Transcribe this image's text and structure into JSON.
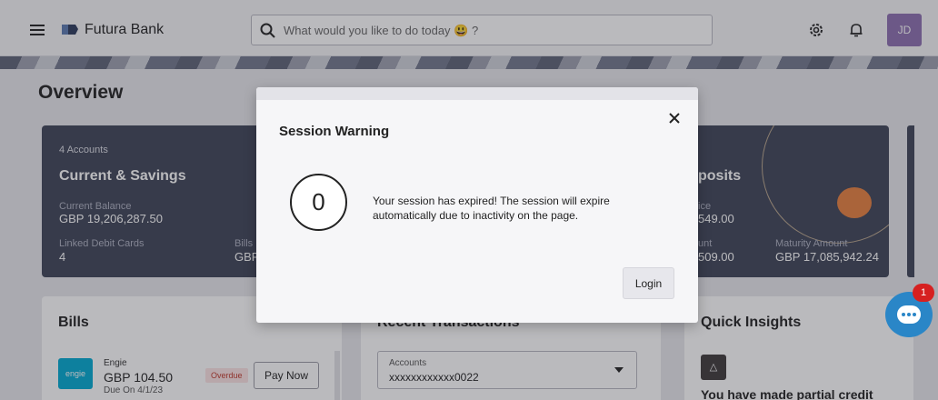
{
  "header": {
    "brand": "Futura Bank",
    "search_placeholder": "What would you like to do today 😃 ?",
    "avatar_initials": "JD"
  },
  "page": {
    "title": "Overview"
  },
  "summary_card": {
    "accounts_count": "4 Accounts",
    "heading": "Current & Savings",
    "current_balance_label": "Current Balance",
    "current_balance_value": "GBP 19,206,287.50",
    "linked_cards_label": "Linked Debit Cards",
    "linked_cards_value": "4",
    "bills_label": "Bills",
    "bills_value": "GBP",
    "deposits_heading": "posits",
    "deposit_label_1": "ice",
    "deposit_value_1": "549.00",
    "deposit_label_2": "unt",
    "deposit_value_2": "509.00",
    "maturity_label": "Maturity Amount",
    "maturity_value": "GBP 17,085,942.24"
  },
  "bills_panel": {
    "title": "Bills",
    "logo_text": "engie",
    "payee": "Engie",
    "amount": "GBP 104.50",
    "due": "Due On 4/1/23",
    "status": "Overdue",
    "pay_label": "Pay Now"
  },
  "transactions_panel": {
    "title": "Recent Transactions",
    "select_label": "Accounts",
    "select_value": "xxxxxxxxxxxx0022"
  },
  "insights_panel": {
    "title": "Quick Insights",
    "icon_glyph": "△",
    "text": "You have made partial credit"
  },
  "modal": {
    "title": "Session Warning",
    "countdown": "0",
    "message": "Your session has expired! The session will expire automatically due to inactivity on the page.",
    "login_label": "Login"
  },
  "chat": {
    "badge_count": "1"
  },
  "colors": {
    "card_dark": "#3e4457",
    "accent_orange": "#e7803f",
    "chat_blue": "#2a86c7",
    "badge_red": "#d62020"
  }
}
